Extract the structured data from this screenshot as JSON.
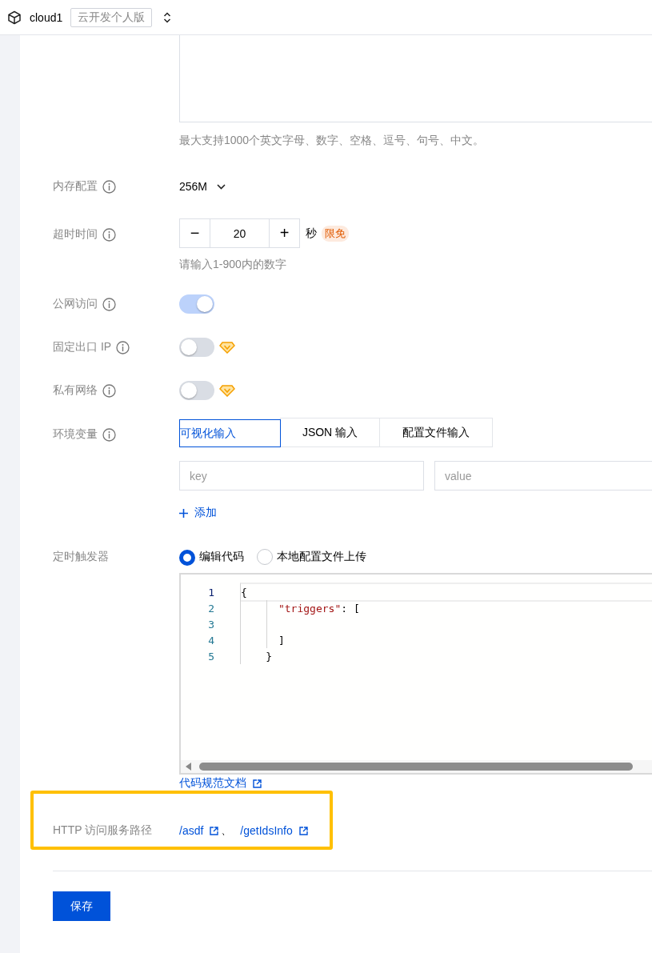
{
  "header": {
    "project": "cloud1",
    "edition": "云开发个人版"
  },
  "description": {
    "hint": "最大支持1000个英文字母、数字、空格、逗号、句号、中文。"
  },
  "fields": [
    {
      "kind": "select",
      "label": "内存配置",
      "info": true,
      "value": "256M"
    },
    {
      "kind": "stepper",
      "label": "超时时间",
      "info": true,
      "minus": "−",
      "value": "20",
      "plus": "+",
      "unit": "秒",
      "badge": "限免",
      "hint": "请输入1-900内的数字"
    },
    {
      "kind": "switch",
      "label": "公网访问",
      "info": true,
      "on": true,
      "premium": false
    },
    {
      "kind": "switch",
      "label": "固定出口 IP",
      "info": true,
      "on": false,
      "premium": true
    },
    {
      "kind": "switch",
      "label": "私有网络",
      "info": true,
      "on": false,
      "premium": true
    },
    {
      "kind": "env",
      "label": "环境变量",
      "info": true,
      "tabs": [
        {
          "label": "可视化输入",
          "selected": true
        },
        {
          "label": "JSON 输入",
          "selected": false
        },
        {
          "label": "配置文件输入",
          "selected": false
        }
      ],
      "key_placeholder": "key",
      "value_placeholder": "value",
      "add": "添加"
    },
    {
      "kind": "trigger",
      "label": "定时触发器",
      "info": false,
      "options": [
        {
          "label": "编辑代码",
          "selected": true
        },
        {
          "label": "本地配置文件上传",
          "selected": false
        }
      ],
      "code": [
        {
          "number": "1",
          "tokens": [
            {
              "kind": "punct",
              "text": "{"
            }
          ]
        },
        {
          "number": "2",
          "tokens": [
            {
              "kind": "string",
              "text": "      \"triggers\""
            },
            {
              "kind": "punct",
              "text": ": ["
            }
          ]
        },
        {
          "number": "3"
        },
        {
          "number": "4",
          "tokens": [
            {
              "kind": "punct",
              "text": "      ]"
            }
          ]
        },
        {
          "number": "5",
          "tokens": [
            {
              "kind": "punct",
              "text": "    }"
            }
          ]
        }
      ],
      "doc_link": "代码规范文档"
    },
    {
      "kind": "http",
      "label": "HTTP 访问服务路径",
      "info": false,
      "highlighted": true,
      "links": [
        "/asdf",
        "/getIdsInfo"
      ],
      "separator": "、"
    }
  ],
  "save": "保存"
}
